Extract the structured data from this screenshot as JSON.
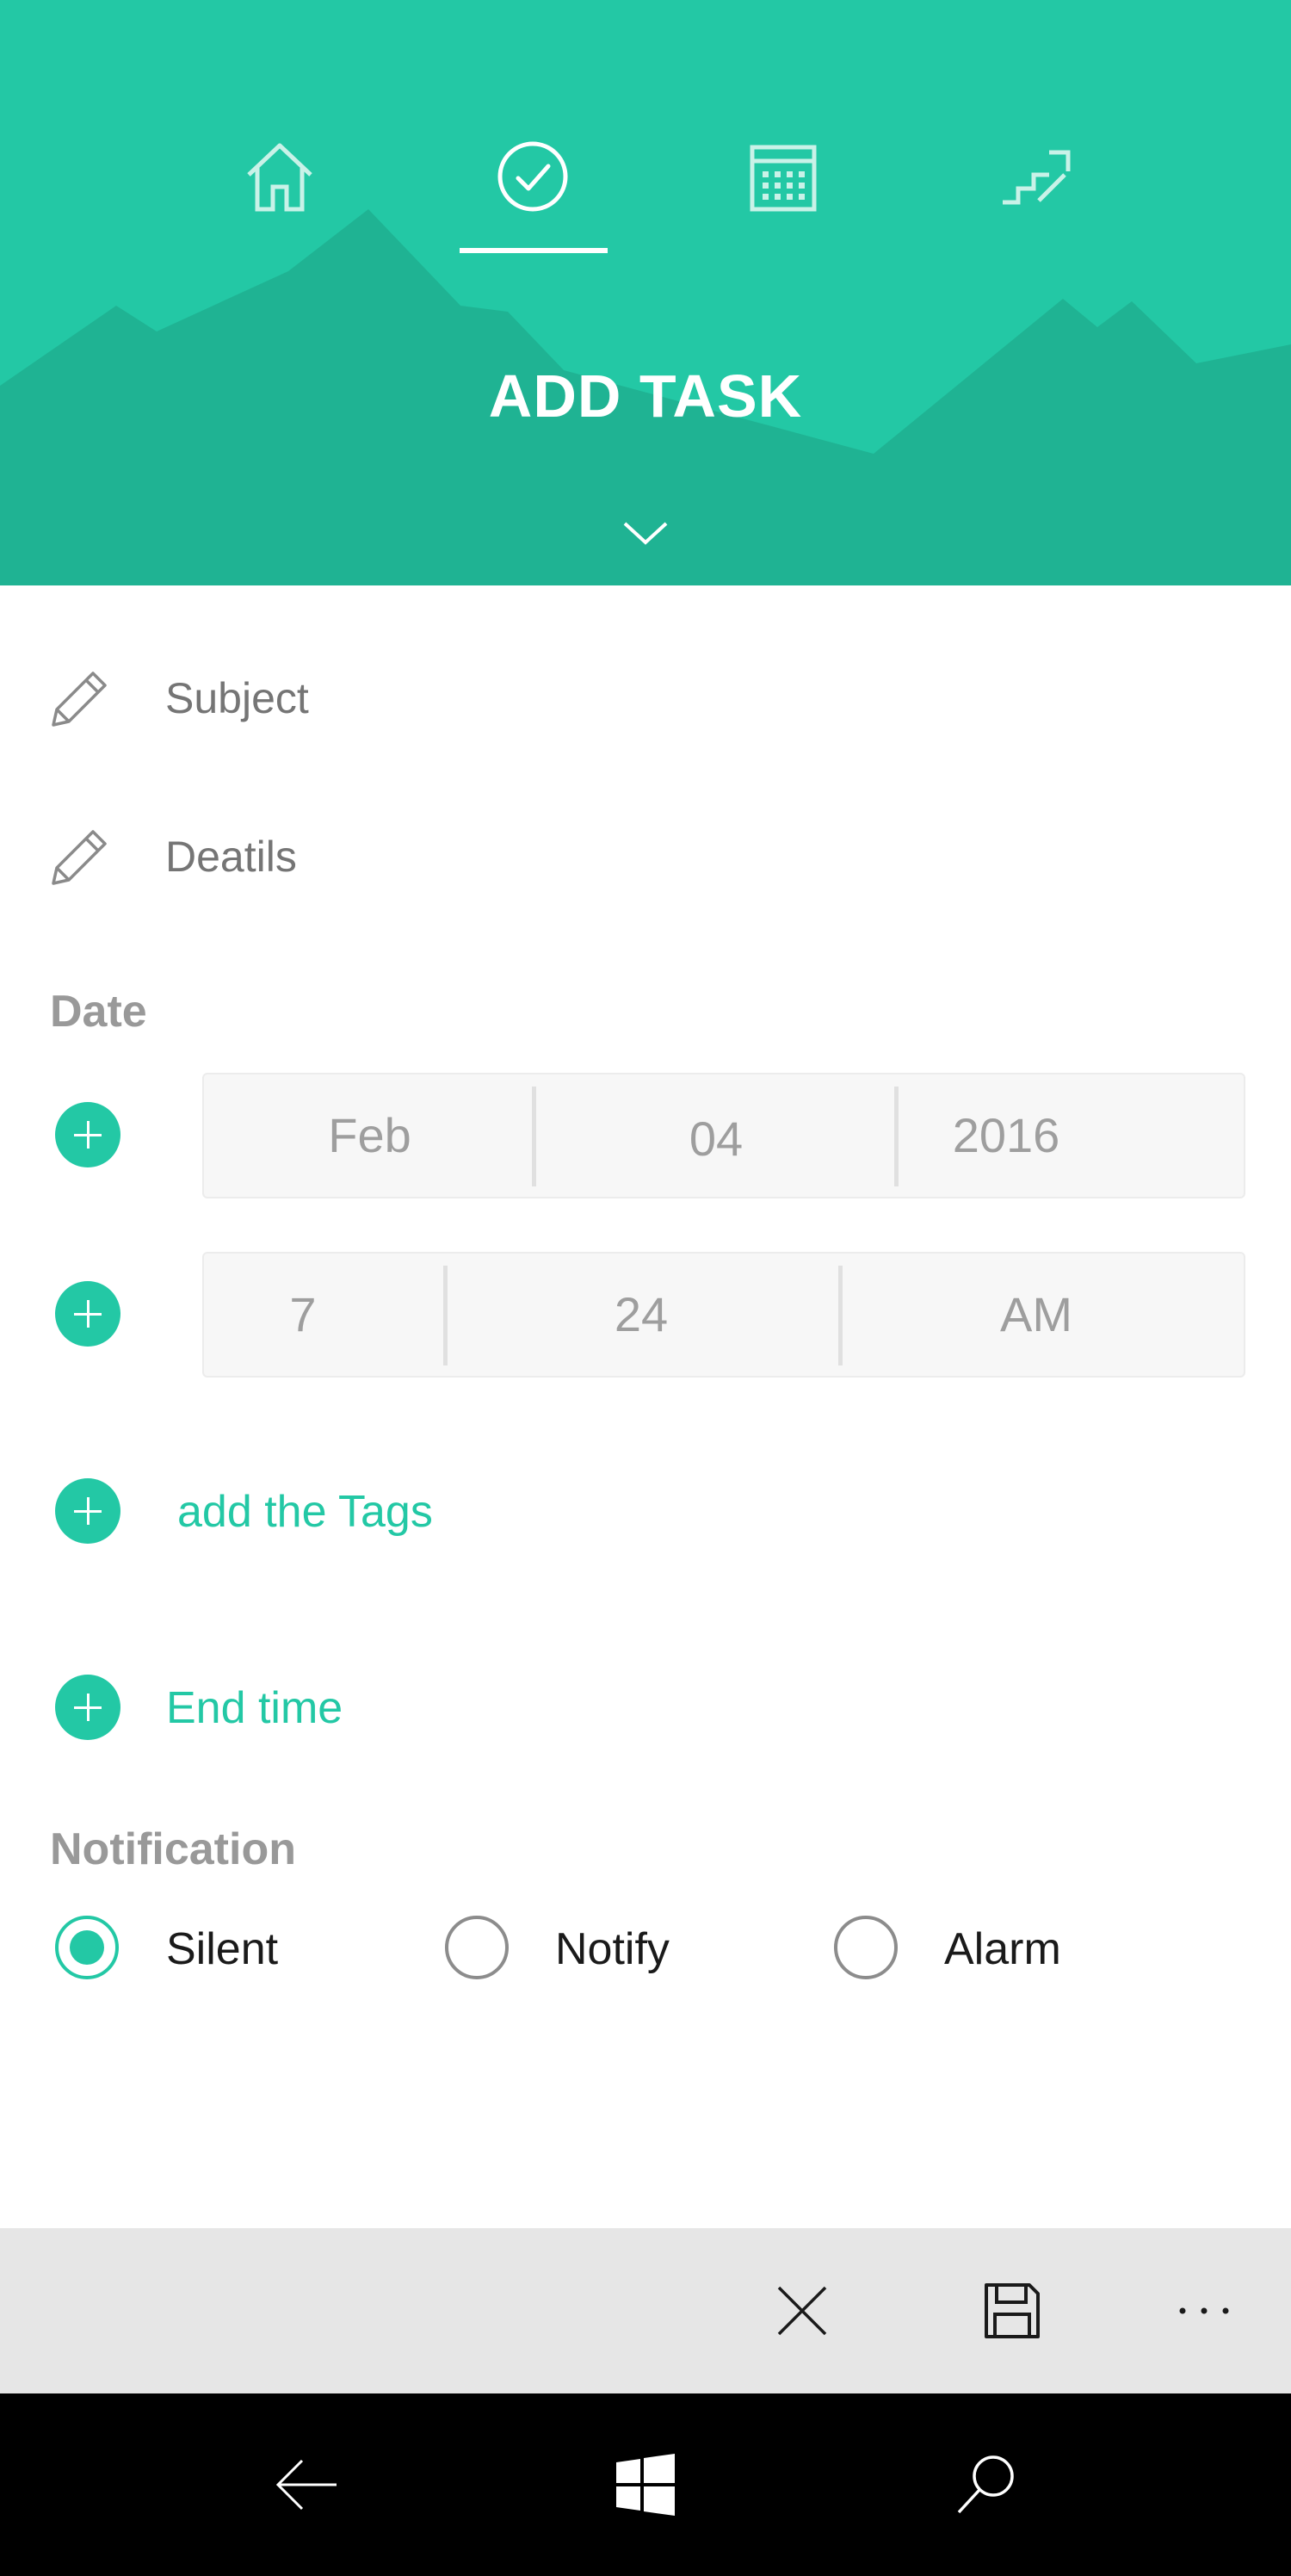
{
  "header": {
    "title": "ADD TASK",
    "active_tab": "tasks",
    "tabs": [
      {
        "name": "home",
        "icon": "home-icon"
      },
      {
        "name": "tasks",
        "icon": "check-circle-icon"
      },
      {
        "name": "calendar",
        "icon": "calendar-icon"
      },
      {
        "name": "stats",
        "icon": "stairs-icon"
      }
    ],
    "accent_color": "#23c8a5",
    "mountain_color": "#1fb393"
  },
  "form": {
    "subject_placeholder": "Subject",
    "details_placeholder": "Deatils",
    "date_label": "Date",
    "date": {
      "month": "Feb",
      "day": "04",
      "year": "2016"
    },
    "time": {
      "hour": "7",
      "minute": "24",
      "period": "AM"
    },
    "tags_link": "add the Tags",
    "end_time_link": "End time",
    "notification_label": "Notification",
    "notification_options": [
      {
        "label": "Silent",
        "selected": true
      },
      {
        "label": "Notify",
        "selected": false
      },
      {
        "label": "Alarm",
        "selected": false
      }
    ]
  },
  "app_bar": {
    "buttons": [
      "close-icon",
      "save-icon",
      "more-icon"
    ],
    "background": "#e6e6e6"
  },
  "system_bar": {
    "buttons": [
      "back-arrow-icon",
      "windows-start-icon",
      "search-icon"
    ]
  }
}
